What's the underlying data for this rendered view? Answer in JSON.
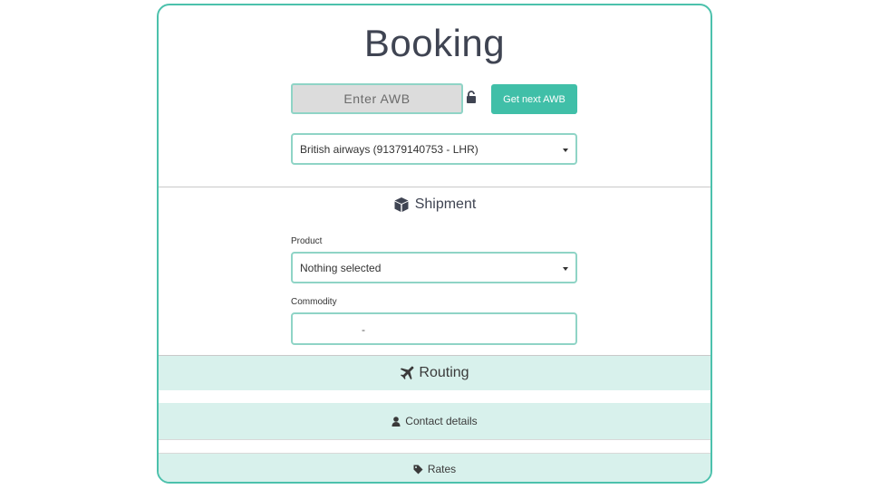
{
  "page": {
    "title": "Booking"
  },
  "awb": {
    "placeholder": "Enter AWB",
    "next_button": "Get next AWB",
    "lock_icon": "unlock-icon"
  },
  "airline_select": {
    "selected": "British airways (91379140753 - LHR)"
  },
  "shipment": {
    "heading": "Shipment",
    "icon": "box-icon",
    "product_label": "Product",
    "product_selected": "Nothing selected",
    "commodity_label": "Commodity",
    "commodity_value": "-"
  },
  "sections": {
    "routing": "Routing",
    "contact": "Contact details",
    "rates": "Rates"
  },
  "colors": {
    "accent": "#40bfa8",
    "border": "#8fd4c6",
    "band": "#d8f1ec"
  }
}
